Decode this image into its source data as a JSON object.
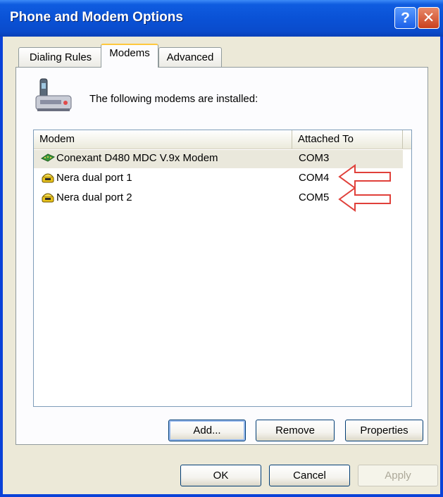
{
  "window": {
    "title": "Phone and Modem Options"
  },
  "titlebar": {
    "help_glyph": "?",
    "close_glyph": "✕"
  },
  "tabs": [
    {
      "label": "Dialing Rules"
    },
    {
      "label": "Modems"
    },
    {
      "label": "Advanced"
    }
  ],
  "panel": {
    "intro_text": "The following modems are  installed:",
    "columns": {
      "modem": "Modem",
      "attached": "Attached To"
    },
    "rows": [
      {
        "name": "Conexant D480 MDC V.9x Modem",
        "port": "COM3",
        "icon": "modem-card-icon"
      },
      {
        "name": "Nera dual port 1",
        "port": "COM4",
        "icon": "phone-modem-icon"
      },
      {
        "name": "Nera dual port 2",
        "port": "COM5",
        "icon": "phone-modem-icon"
      }
    ],
    "buttons": {
      "add": "Add...",
      "remove": "Remove",
      "properties": "Properties"
    }
  },
  "footer": {
    "ok": "OK",
    "cancel": "Cancel",
    "apply": "Apply"
  },
  "colors": {
    "titlebar": "#0a52d6",
    "face": "#ece9d8",
    "annotation_arrow": "#e0403a"
  }
}
